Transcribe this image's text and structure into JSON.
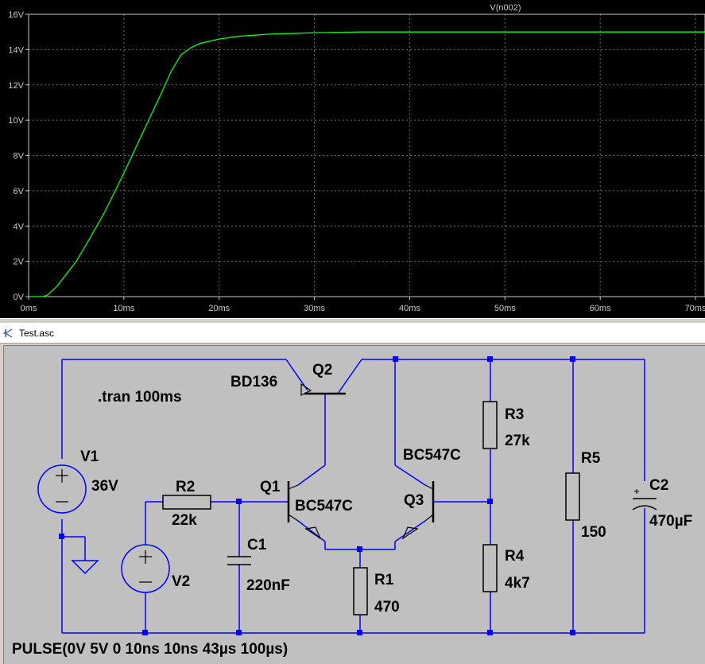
{
  "plot": {
    "chart_data": {
      "type": "line",
      "title": "",
      "xlabel": "",
      "ylabel": "",
      "xlim": [
        0,
        71
      ],
      "ylim": [
        0,
        16
      ],
      "x_ticks": [
        "0ms",
        "10ms",
        "20ms",
        "30ms",
        "40ms",
        "50ms",
        "60ms",
        "70ms"
      ],
      "y_ticks": [
        "0V",
        "2V",
        "4V",
        "6V",
        "8V",
        "10V",
        "12V",
        "14V",
        "16V"
      ],
      "grid": true,
      "legend_position": "top",
      "series": [
        {
          "name": "V(n002)",
          "color": "#00ff00",
          "x": [
            0,
            1.5,
            2,
            3,
            4,
            5,
            6,
            8,
            10,
            12,
            14,
            15,
            16,
            17,
            18,
            20,
            22,
            25,
            30,
            35,
            40,
            50,
            60,
            71
          ],
          "y": [
            0,
            0,
            0.1,
            0.6,
            1.3,
            2.0,
            2.9,
            4.8,
            7.0,
            9.3,
            11.6,
            12.8,
            13.7,
            14.1,
            14.35,
            14.6,
            14.75,
            14.87,
            14.96,
            15.0,
            15.0,
            15.0,
            15.0,
            15.0
          ]
        }
      ]
    }
  },
  "schematic": {
    "window_title": "Test.asc",
    "directive": ".tran 100ms",
    "source_spec": "PULSE(0V 5V 0 10ns 10ns 43µs 100µs)",
    "wire_color": "#0000ff",
    "components": {
      "v1": {
        "name": "V1",
        "value": "36V"
      },
      "v2": {
        "name": "V2"
      },
      "r1": {
        "name": "R1",
        "value": "470"
      },
      "r2": {
        "name": "R2",
        "value": "22k"
      },
      "r3": {
        "name": "R3",
        "value": "27k"
      },
      "r4": {
        "name": "R4",
        "value": "4k7"
      },
      "r5": {
        "name": "R5",
        "value": "150"
      },
      "c1": {
        "name": "C1",
        "value": "220nF"
      },
      "c2": {
        "name": "C2",
        "value": "470µF"
      },
      "q1": {
        "name": "Q1",
        "model": "BC547C"
      },
      "q2": {
        "name": "Q2",
        "model": "BD136"
      },
      "q3": {
        "name": "Q3",
        "model": "BC547C"
      }
    }
  }
}
